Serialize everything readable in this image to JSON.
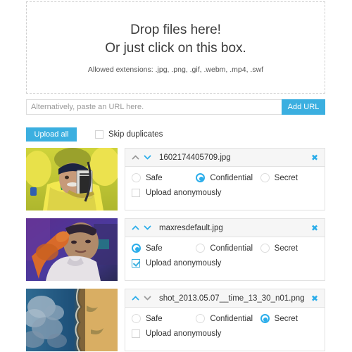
{
  "dropzone": {
    "line1": "Drop files here!",
    "line2": "Or just click on this box.",
    "extensions": "Allowed extensions: .jpg, .png, .gif, .webm, .mp4, .swf"
  },
  "url_row": {
    "placeholder": "Alternatively, paste an URL here.",
    "value": "",
    "add_button": "Add URL"
  },
  "actions": {
    "upload_all": "Upload all",
    "skip_duplicates_label": "Skip duplicates",
    "skip_duplicates_checked": false
  },
  "colors": {
    "accent": "#3bafe0",
    "radio_selected": "#2badea",
    "panel_border": "#e2e2e2",
    "panel_header_bg": "#f6f6f6",
    "dropzone_border": "#cfcfcf"
  },
  "privacy_options": [
    "Safe",
    "Confidential",
    "Secret"
  ],
  "anonymous_label": "Upload anonymously",
  "close_icon": "✖",
  "files": [
    {
      "name": "1602174405709.jpg",
      "privacy": "Confidential",
      "anonymous": false,
      "move_up_enabled": false,
      "move_down_enabled": true,
      "thumb_alt": "man-in-brazil-jersey-holding-trophy"
    },
    {
      "name": "maxresdefault.jpg",
      "privacy": "Safe",
      "anonymous": true,
      "move_up_enabled": true,
      "move_down_enabled": true,
      "thumb_alt": "man-in-purple-light-hand-near-face"
    },
    {
      "name": "shot_2013.05.07__time_13_30_n01.png",
      "privacy": "Secret",
      "anonymous": false,
      "move_up_enabled": true,
      "move_down_enabled": false,
      "thumb_alt": "aerial-coastline-clouds-blue-and-gold"
    }
  ]
}
